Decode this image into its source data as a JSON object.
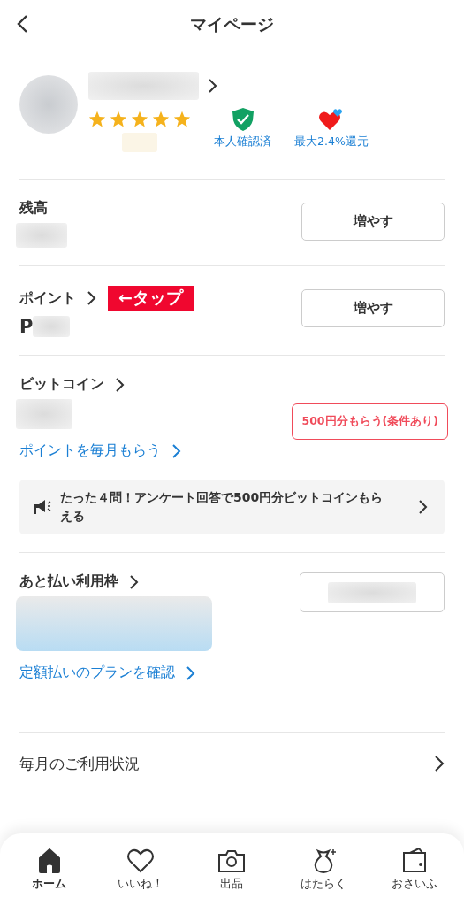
{
  "header": {
    "title": "マイページ"
  },
  "profile": {
    "stars": 5,
    "badges": [
      {
        "kind": "verified",
        "label": "本人確認済"
      },
      {
        "kind": "cashback",
        "label": "最大2.4%還元"
      }
    ]
  },
  "balance": {
    "label": "残高",
    "button": "増やす"
  },
  "points": {
    "label": "ポイント",
    "tag": "←タップ",
    "prefix": "P",
    "button": "増やす"
  },
  "bitcoin": {
    "label": "ビットコイン",
    "offer_button": "500円分もらう(条件あり)",
    "link": "ポイントを毎月もらう",
    "banner": "たった４問！アンケート回答で500円分ビットコインもらえる"
  },
  "postpay": {
    "label": "あと払い利用枠",
    "link": "定額払いのプランを確認"
  },
  "menu": [
    {
      "label": "毎月のご利用状況"
    }
  ],
  "tabs": [
    {
      "kind": "home",
      "label": "ホーム",
      "selected": true
    },
    {
      "kind": "like",
      "label": "いいね！",
      "selected": false
    },
    {
      "kind": "sell",
      "label": "出品",
      "selected": false
    },
    {
      "kind": "work",
      "label": "はたらく",
      "selected": false
    },
    {
      "kind": "wallet",
      "label": "おさいふ",
      "selected": false
    }
  ]
}
